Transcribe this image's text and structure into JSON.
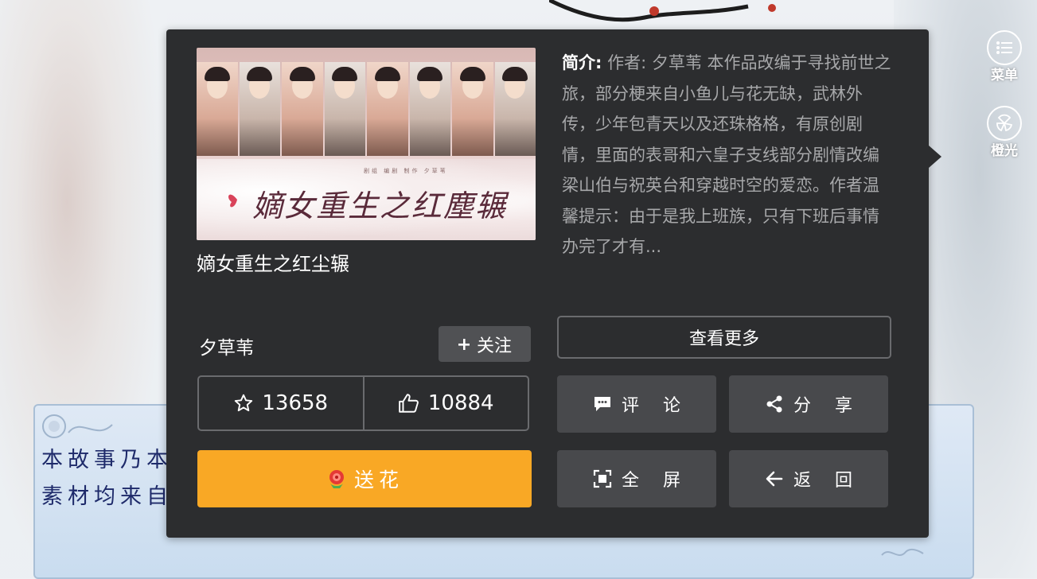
{
  "side_menu": {
    "menu_label": "菜单",
    "light_label": "橙光",
    "menu_icon": "list-icon",
    "light_icon": "orange-light-logo-icon"
  },
  "story_dialog": {
    "line1": "本故事乃本",
    "line2": "素材均来自"
  },
  "work": {
    "title": "嫡女重生之红尘辗",
    "cover_calligraphy": "嫡女重生之红塵辗",
    "cover_credit": "剧组 编剧 制作 夕草苇",
    "intro_label": "简介:",
    "intro_text": "作者: 夕草苇 本作品改编于寻找前世之旅，部分梗来自小鱼儿与花无缺，武林外传，少年包青天以及还珠格格，有原创剧情，里面的表哥和六皇子支线部分剧情改编梁山伯与祝英台和穿越时空的爱恋。作者温馨提示：由于是我上班族，只有下班后事情办完了才有..."
  },
  "author": {
    "name": "夕草苇",
    "follow_label": "关注"
  },
  "stats": {
    "favorites": "13658",
    "likes": "10884"
  },
  "actions": {
    "send_flower": "送花",
    "view_more": "查看更多",
    "comment": "评论",
    "share": "分享",
    "fullscreen": "全屏",
    "back": "返回"
  },
  "colors": {
    "popup_bg": "#2c2d2f",
    "flower_button": "#f9a825",
    "gray_button": "#48494c"
  }
}
